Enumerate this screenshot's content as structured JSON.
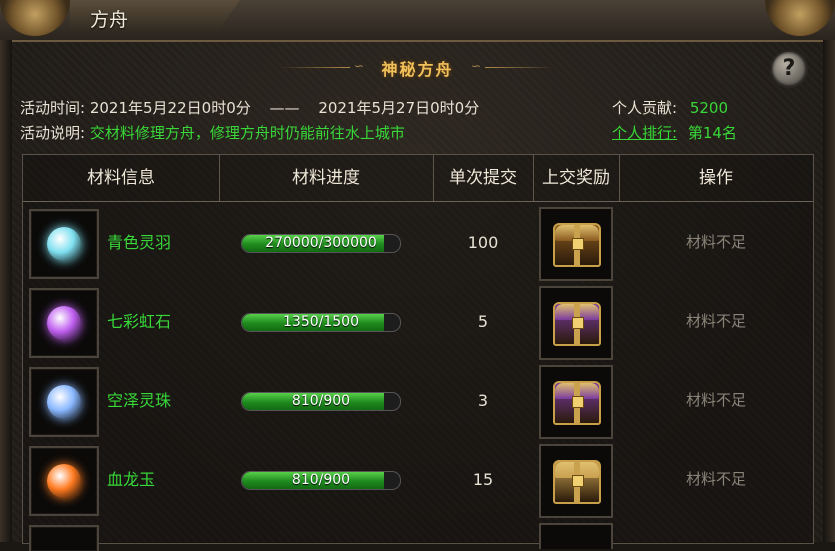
{
  "window": {
    "title": "方舟"
  },
  "banner": {
    "title": "神秘方舟"
  },
  "info": {
    "time_label": "活动时间:",
    "time_start": "2021年5月22日0时0分",
    "time_dash": "——",
    "time_end": "2021年5月27日0时0分",
    "desc_label": "活动说明:",
    "desc_text": "交材料修理方舟，修理方舟时仍能前往水上城市",
    "contribution_label": "个人贡献:",
    "contribution_value": "5200",
    "rank_label": "个人排行:",
    "rank_value": "第14名"
  },
  "help": {
    "label": "?"
  },
  "table": {
    "headers": [
      "材料信息",
      "材料进度",
      "单次提交",
      "上交奖励",
      "操作"
    ],
    "rows": [
      {
        "name": "青色灵羽",
        "progress_text": "270000/300000",
        "progress": 0.9,
        "qty": "100",
        "action": "材料不足",
        "gem_color": "#7fe0f0",
        "chest_color": "#8a5a20"
      },
      {
        "name": "七彩虹石",
        "progress_text": "1350/1500",
        "progress": 0.9,
        "qty": "5",
        "action": "材料不足",
        "gem_color": "#c060f0",
        "chest_color": "#7a3aa0"
      },
      {
        "name": "空泽灵珠",
        "progress_text": "810/900",
        "progress": 0.9,
        "qty": "3",
        "action": "材料不足",
        "gem_color": "#8ab8ff",
        "chest_color": "#7a3aa0"
      },
      {
        "name": "血龙玉",
        "progress_text": "810/900",
        "progress": 0.9,
        "qty": "15",
        "action": "材料不足",
        "gem_color": "#ff7a20",
        "chest_color": "#c8a050"
      }
    ]
  }
}
